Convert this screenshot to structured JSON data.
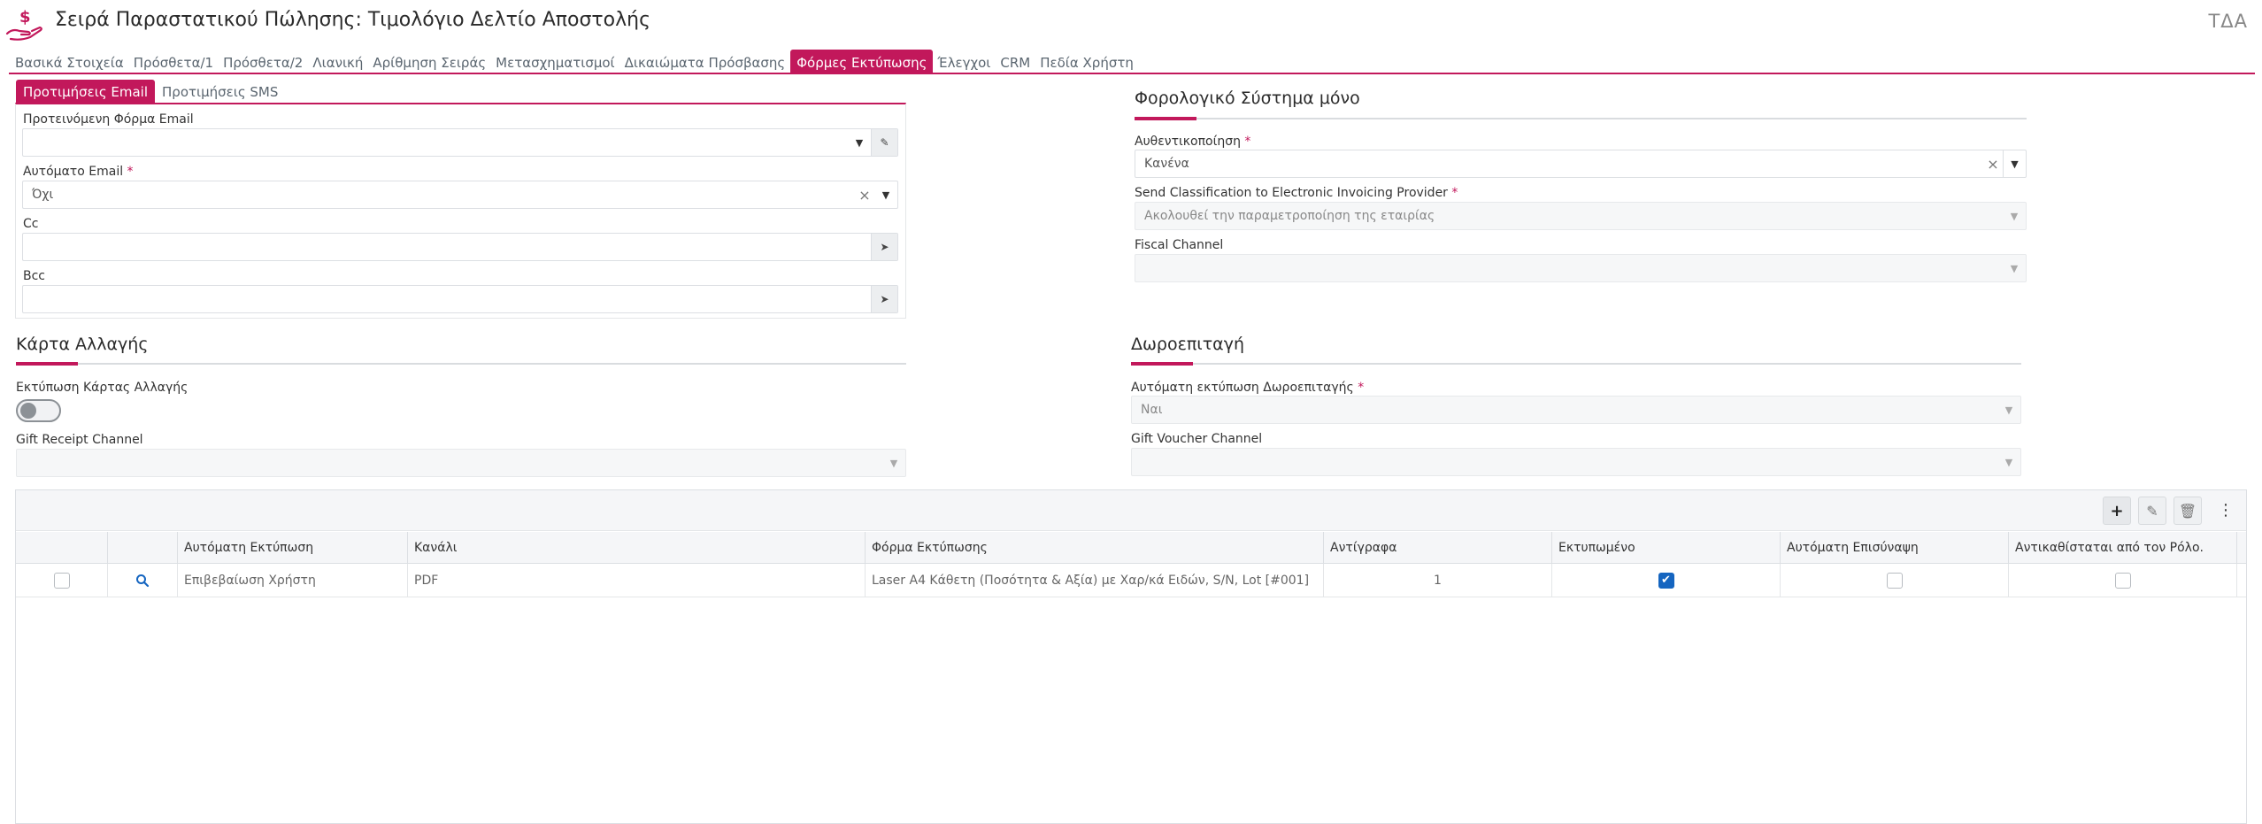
{
  "header": {
    "title": "Σειρά Παραστατικού Πώλησης: Τιμολόγιο Δελτίο Αποστολής",
    "top_right": "ΤΔΑ",
    "icon": "dollar-hand-icon"
  },
  "tabs": [
    {
      "label": "Βασικά Στοιχεία"
    },
    {
      "label": "Πρόσθετα/1"
    },
    {
      "label": "Πρόσθετα/2"
    },
    {
      "label": "Λιανική"
    },
    {
      "label": "Αρίθμηση Σειράς"
    },
    {
      "label": "Μετασχηματισμοί"
    },
    {
      "label": "Δικαιώματα Πρόσβασης"
    },
    {
      "label": "Φόρμες Εκτύπωσης",
      "active": true
    },
    {
      "label": "Έλεγχοι"
    },
    {
      "label": "CRM"
    },
    {
      "label": "Πεδία Χρήστη"
    }
  ],
  "subtabs": [
    {
      "label": "Προτιμήσεις Email",
      "active": true
    },
    {
      "label": "Προτιμήσεις SMS"
    }
  ],
  "email": {
    "form_label": "Προτεινόμενη Φόρμα Email",
    "form_value": "",
    "auto_label": "Αυτόματο Email",
    "auto_value": "Όχι",
    "cc_label": "Cc",
    "cc_value": "",
    "bcc_label": "Bcc",
    "bcc_value": ""
  },
  "fiscal": {
    "title": "Φορολογικό Σύστημα μόνο",
    "auth_label": "Αυθεντικοποίηση",
    "auth_value": "Κανένα",
    "classification_label": "Send Classification to Electronic Invoicing Provider",
    "classification_value": "Ακολουθεί την παραμετροποίηση της εταιρίας",
    "channel_label": "Fiscal Channel",
    "channel_value": ""
  },
  "change_card": {
    "title": "Κάρτα Αλλαγής",
    "print_label": "Εκτύπωση Κάρτας Αλλαγής",
    "print_enabled": false,
    "channel_label": "Gift Receipt Channel",
    "channel_value": ""
  },
  "gift_voucher": {
    "title": "Δωροεπιταγή",
    "auto_label": "Αυτόματη εκτύπωση Δωροεπιταγής",
    "auto_value": "Ναι",
    "channel_label": "Gift Voucher Channel",
    "channel_value": ""
  },
  "required_mark": "*",
  "grid": {
    "columns": [
      "Αυτόματη Εκτύπωση",
      "Κανάλι",
      "Φόρμα Εκτύπωσης",
      "Αντίγραφα",
      "Εκτυπωμένο",
      "Αυτόματη Επισύναψη",
      "Αντικαθίσταται από τον Ρόλο."
    ],
    "rows": [
      {
        "auto_print": "Επιβεβαίωση Χρήστη",
        "channel": "PDF",
        "form": "Laser A4 Κάθετη (Ποσότητα & Αξία) με Χαρ/κά Ειδών, S/N, Lot [#001]",
        "copies": "1",
        "printed": true,
        "auto_attach": false,
        "overridden_by_role": false,
        "selected": false
      }
    ]
  },
  "colors": {
    "accent": "#c2185b",
    "checkbox_on": "#1565c0"
  }
}
